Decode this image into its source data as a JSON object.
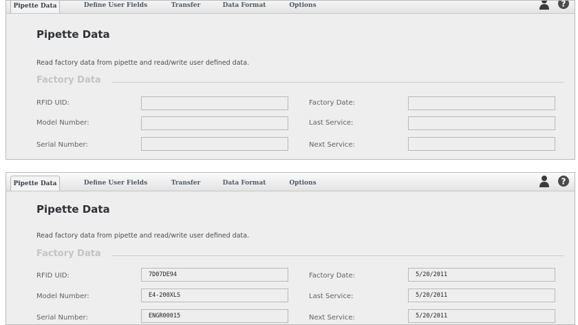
{
  "tabs": [
    {
      "label": "Pipette Data"
    },
    {
      "label": "Define User Fields"
    },
    {
      "label": "Transfer"
    },
    {
      "label": "Data Format"
    },
    {
      "label": "Options"
    }
  ],
  "toolbar_icons": [
    "user-icon",
    "help-icon"
  ],
  "page": {
    "title": "Pipette Data",
    "description": "Read factory data from pipette and read/write user defined data.",
    "section_title": "Factory Data"
  },
  "labels": {
    "rfid_uid": "RFID UID:",
    "model_number": "Model Number:",
    "serial_number": "Serial Number:",
    "factory_date": "Factory Date:",
    "last_service": "Last Service:",
    "next_service": "Next Service:"
  },
  "before": {
    "rfid_uid": "",
    "model_number": "",
    "serial_number": "",
    "factory_date": "",
    "last_service": "",
    "next_service": ""
  },
  "after": {
    "rfid_uid": "7D07DE94",
    "model_number": "E4-200XLS",
    "serial_number": "ENGR00015",
    "factory_date": "5/20/2011",
    "last_service": "5/20/2011",
    "next_service": "5/20/2011"
  },
  "colors": {
    "panel_bg": "#eeeeee",
    "tab_text": "#4f5a6b",
    "section_title": "#c3c4c6"
  }
}
